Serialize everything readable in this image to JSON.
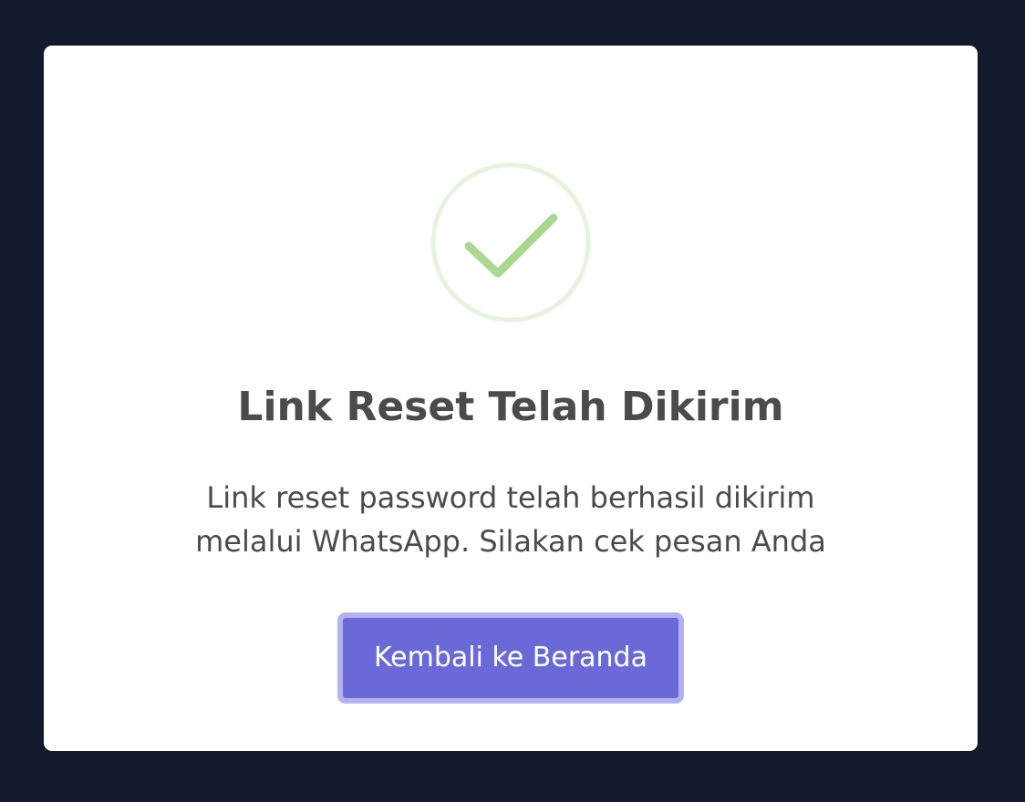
{
  "dialog": {
    "icon": "check-circle-icon",
    "title": "Link Reset Telah Dikirim",
    "message_lines": [
      "Link reset password telah berhasil dikirim",
      "melalui WhatsApp. Silakan cek pesan Anda"
    ],
    "button_label": "Kembali ke Beranda"
  },
  "colors": {
    "background": "#121a2c",
    "card": "#ffffff",
    "text": "#4b4b4b",
    "success_check": "#a8d98e",
    "success_ring": "#e6f4de",
    "button": "#6b69d8",
    "button_ring": "#b3b1f1"
  }
}
